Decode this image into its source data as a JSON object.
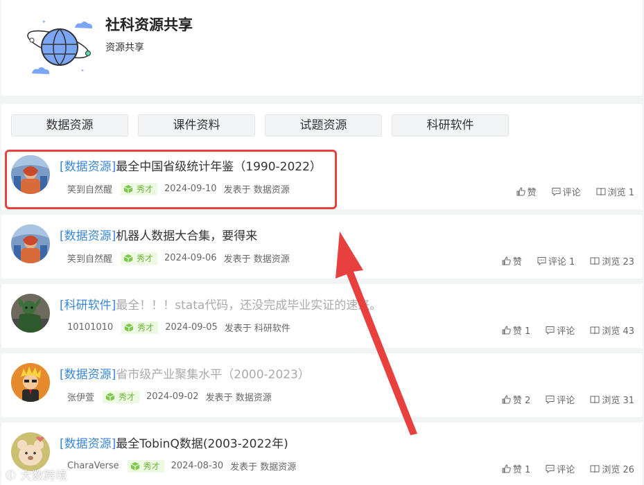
{
  "group": {
    "title": "社科资源共享",
    "subtitle": "资源共享"
  },
  "tabs": [
    {
      "label": "数据资源"
    },
    {
      "label": "课件资料"
    },
    {
      "label": "试题资源"
    },
    {
      "label": "科研软件"
    }
  ],
  "posts": [
    {
      "category": "[数据资源]",
      "title": "最全中国省级统计年鉴（1990-2022）",
      "faded": false,
      "author": "笑到自然醒",
      "badge": "秀才",
      "date": "2024-09-10",
      "source": "发表于 数据资源",
      "likes": "赞",
      "comments": "评论",
      "views": "浏览 1"
    },
    {
      "category": "[数据资源]",
      "title": "机器人数据大合集，要得来",
      "faded": false,
      "author": "笑到自然醒",
      "badge": "秀才",
      "date": "2024-09-06",
      "source": "发表于 数据资源",
      "likes": "赞",
      "comments": "评论 1",
      "views": "浏览 23"
    },
    {
      "category": "[科研软件]",
      "title": "最全！！！stata代码，还没完成毕业实证的速来。",
      "faded": true,
      "author": "10101010",
      "badge": "秀才",
      "date": "2024-09-05",
      "source": "发表于 科研软件",
      "likes": "赞 1",
      "comments": "评论",
      "views": "浏览 43"
    },
    {
      "category": "[数据资源]",
      "title": "省市级产业聚集水平（2000-2023）",
      "faded": true,
      "author": "张伊萱",
      "badge": "秀才",
      "date": "2024-09-02",
      "source": "发表于 数据资源",
      "likes": "赞 2",
      "comments": "评论",
      "views": "浏览 31"
    },
    {
      "category": "[数据资源]",
      "title": "最全TobinQ数据(2003-2022年)",
      "faded": false,
      "author": "CharaVerse",
      "badge": "秀才",
      "date": "2024-08-30",
      "source": "发表于 数据资源",
      "likes": "赞 1",
      "comments": "评论",
      "views": "浏览 26"
    }
  ],
  "watermark": "大数跨境",
  "colors": {
    "category": "#3a87d6",
    "highlight": "#e8403e",
    "badge_bg": "#eef9e3",
    "badge_text": "#6cb53a"
  }
}
